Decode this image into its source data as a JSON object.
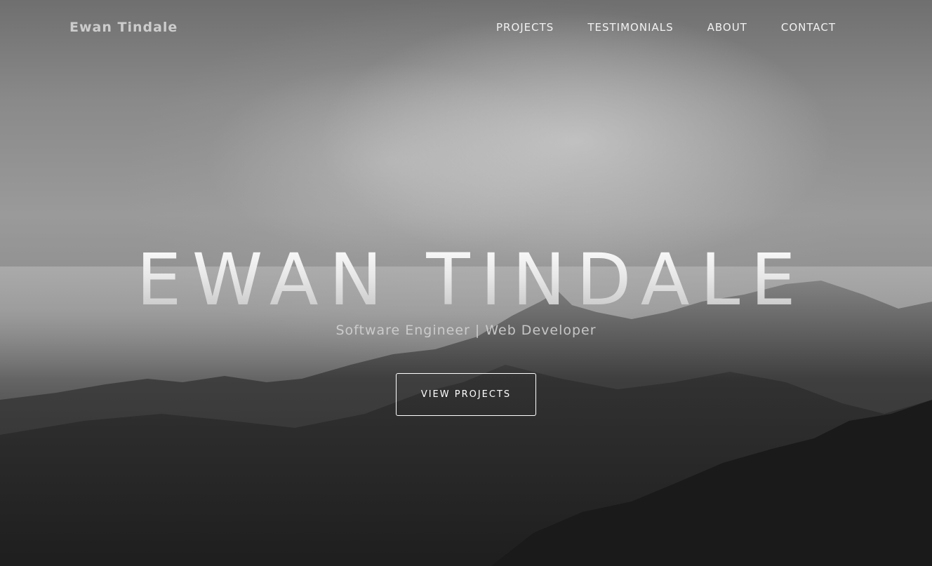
{
  "navbar": {
    "brand": "Ewan Tindale",
    "links": [
      "PROJECTS",
      "TESTIMONIALS",
      "ABOUT",
      "CONTACT"
    ]
  },
  "hero": {
    "title": "EWAN TINDALE",
    "subtitle": "Software Engineer | Web Developer",
    "cta_label": "VIEW PROJECTS"
  }
}
